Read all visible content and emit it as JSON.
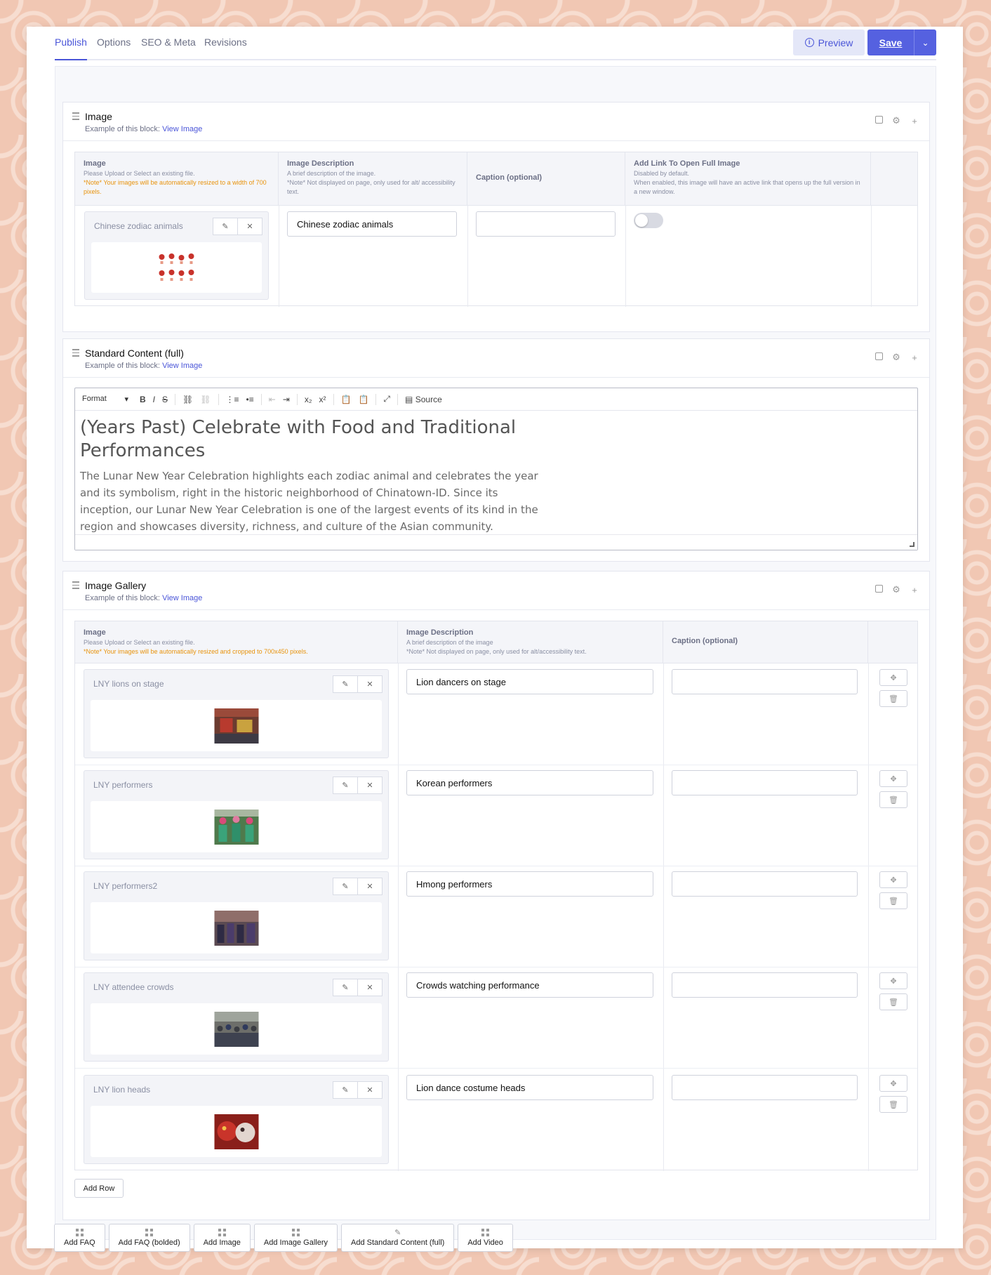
{
  "tabs": [
    {
      "label": "Publish",
      "active": true
    },
    {
      "label": "Options",
      "active": false
    },
    {
      "label": "SEO & Meta",
      "active": false
    },
    {
      "label": "Revisions",
      "active": false
    }
  ],
  "header": {
    "preview_label": "Preview",
    "save_label": "Save"
  },
  "colors": {
    "accent": "#5561e0",
    "note": "#e8930c",
    "muted": "#6c7086"
  },
  "image_block": {
    "title": "Image",
    "example_prefix": "Example of this block:",
    "example_link": "View Image",
    "columns": {
      "image": {
        "title": "Image",
        "sub": "Please Upload or Select an existing file.",
        "note": "*Note* Your images will be automatically resized to a width of 700 pixels."
      },
      "description": {
        "title": "Image Description",
        "sub": "A brief description of the image.",
        "sub2": "*Note* Not displayed on page, only used for alt/ accessibility text."
      },
      "caption": {
        "title": "Caption (optional)"
      },
      "link": {
        "title": "Add Link To Open Full Image",
        "sub": "Disabled by default.",
        "sub2": "When enabled, this image will have an active link that opens up the full version in a new window."
      }
    },
    "row": {
      "file_name": "Chinese zodiac animals",
      "description": "Chinese zodiac animals",
      "caption": "",
      "link_enabled": false
    }
  },
  "content_block": {
    "title": "Standard Content (full)",
    "example_prefix": "Example of this block:",
    "example_link": "View Image",
    "toolbar": {
      "format_label": "Format",
      "source_label": "Source"
    },
    "heading": "(Years Past) Celebrate with Food and Traditional Performances",
    "body": "The Lunar New Year Celebration highlights each zodiac animal and celebrates the year and its symbolism, right in the historic neighborhood of Chinatown-ID. Since its inception, our Lunar New Year Celebration is one of the largest events of its kind in the region and showcases diversity, richness, and culture of the Asian community."
  },
  "gallery_block": {
    "title": "Image Gallery",
    "example_prefix": "Example of this block:",
    "example_link": "View Image",
    "columns": {
      "image": {
        "title": "Image",
        "sub": "Please Upload or Select an existing file.",
        "note": "*Note* Your images will be automatically resized and cropped to 700x450 pixels."
      },
      "description": {
        "title": "Image Description",
        "sub": "A brief description of the image",
        "sub2": "*Note* Not displayed on page, only used for alt/accessibility text."
      },
      "caption": {
        "title": "Caption (optional)"
      }
    },
    "rows": [
      {
        "file_name": "LNY lions on stage",
        "description": "Lion dancers on stage",
        "caption": ""
      },
      {
        "file_name": "LNY performers",
        "description": "Korean performers",
        "caption": ""
      },
      {
        "file_name": "LNY performers2",
        "description": "Hmong performers",
        "caption": ""
      },
      {
        "file_name": "LNY attendee crowds",
        "description": "Crowds watching performance",
        "caption": ""
      },
      {
        "file_name": "LNY lion heads",
        "description": "Lion dance costume heads",
        "caption": ""
      }
    ],
    "add_row_label": "Add Row"
  },
  "add_blocks": [
    {
      "label": "Add FAQ",
      "icon": "grid-icon"
    },
    {
      "label": "Add FAQ (bolded)",
      "icon": "grid-icon"
    },
    {
      "label": "Add Image",
      "icon": "grid-icon"
    },
    {
      "label": "Add Image Gallery",
      "icon": "grid-icon"
    },
    {
      "label": "Add Standard Content (full)",
      "icon": "edit-icon"
    },
    {
      "label": "Add Video",
      "icon": "grid-icon"
    }
  ]
}
